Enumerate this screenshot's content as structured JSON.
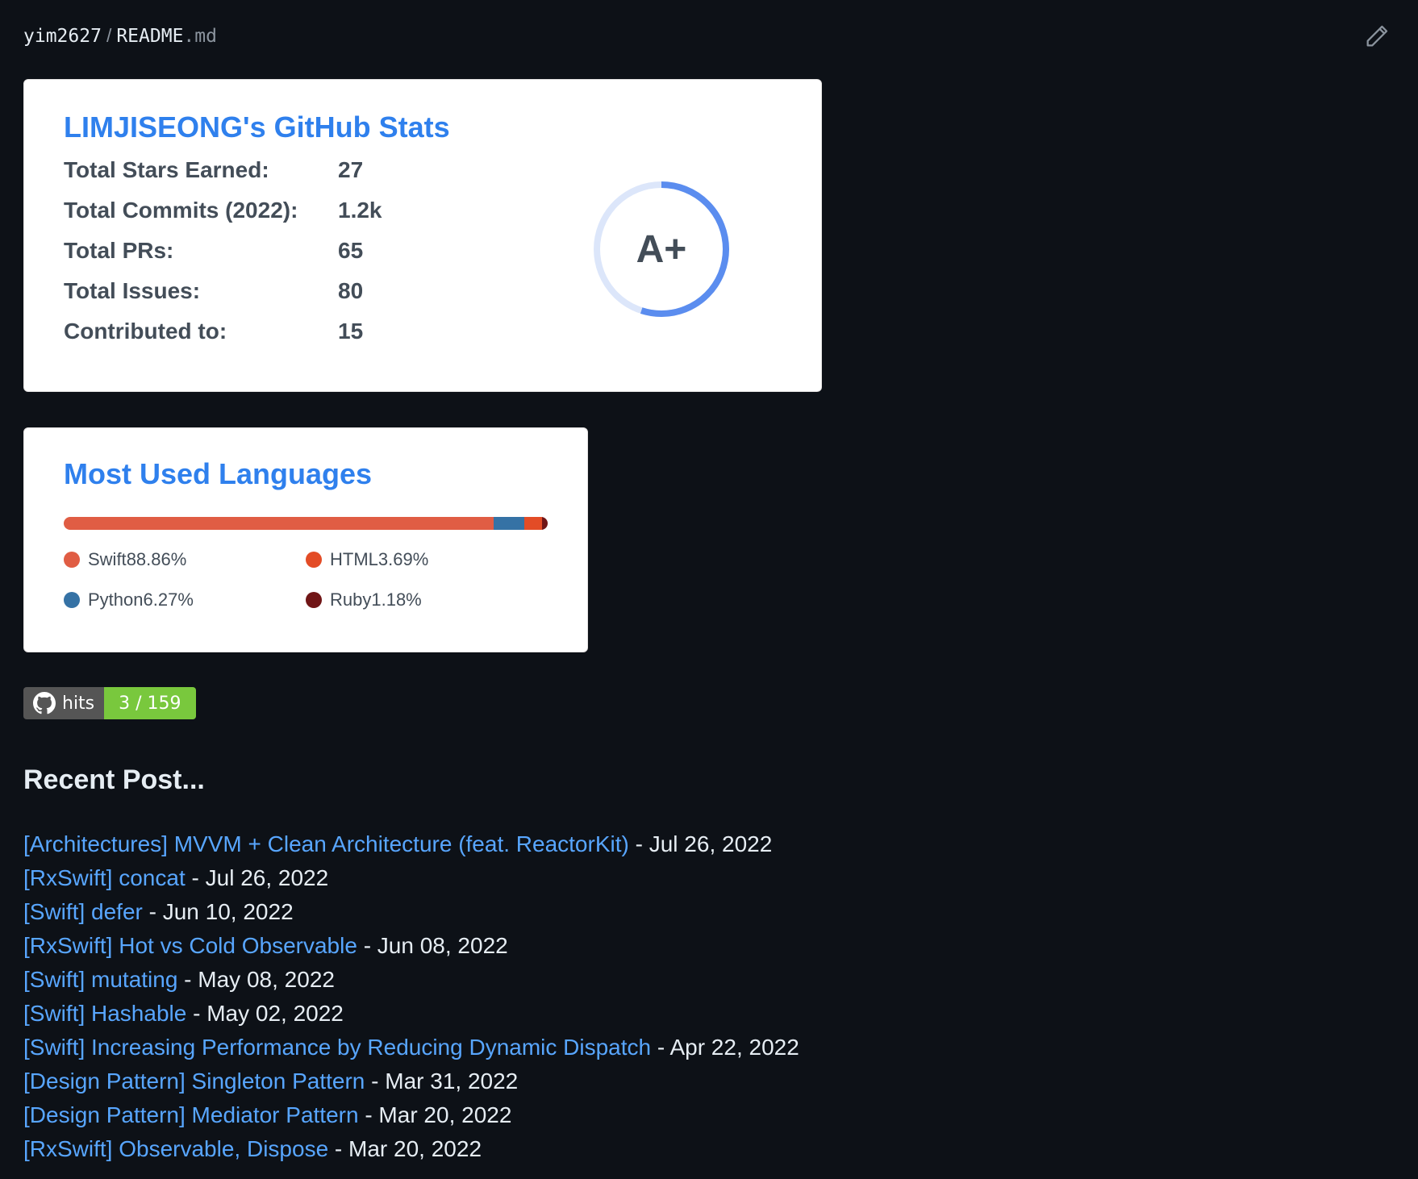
{
  "file_path": {
    "owner": "yim2627",
    "separator": "/",
    "filename": "README",
    "extension": ".md"
  },
  "stats_card": {
    "title": "LIMJISEONG's GitHub Stats",
    "rows": [
      {
        "label": "Total Stars Earned:",
        "value": "27"
      },
      {
        "label": "Total Commits (2022):",
        "value": "1.2k"
      },
      {
        "label": "Total PRs:",
        "value": "65"
      },
      {
        "label": "Total Issues:",
        "value": "80"
      },
      {
        "label": "Contributed to:",
        "value": "15"
      }
    ],
    "rank": "A+",
    "rank_progress": 0.55,
    "colors": {
      "title": "#2f80ed",
      "text": "#434d58",
      "ring": "#5b8def",
      "ring_track": "#dce6fa"
    }
  },
  "languages_card": {
    "title": "Most Used Languages",
    "languages": [
      {
        "name": "Swift",
        "percent": "88.86%",
        "value": 88.86,
        "color": "#e05d44"
      },
      {
        "name": "Python",
        "percent": "6.27%",
        "value": 6.27,
        "color": "#3572a5"
      },
      {
        "name": "HTML",
        "percent": "3.69%",
        "value": 3.69,
        "color": "#e34c26"
      },
      {
        "name": "Ruby",
        "percent": "1.18%",
        "value": 1.18,
        "color": "#701516"
      }
    ]
  },
  "hits_badge": {
    "label": "hits",
    "value": "3 / 159",
    "icon": "github-icon"
  },
  "recent_posts": {
    "heading": "Recent Post...",
    "items": [
      {
        "title": "[Architectures] MVVM + Clean Architecture (feat. ReactorKit)",
        "date": " - Jul 26, 2022"
      },
      {
        "title": "[RxSwift] concat",
        "date": " - Jul 26, 2022"
      },
      {
        "title": "[Swift] defer",
        "date": " - Jun 10, 2022"
      },
      {
        "title": "[RxSwift] Hot vs Cold Observable",
        "date": " - Jun 08, 2022"
      },
      {
        "title": "[Swift] mutating",
        "date": " - May 08, 2022"
      },
      {
        "title": "[Swift] Hashable",
        "date": " - May 02, 2022"
      },
      {
        "title": "[Swift] Increasing Performance by Reducing Dynamic Dispatch",
        "date": " - Apr 22, 2022"
      },
      {
        "title": "[Design Pattern] Singleton Pattern",
        "date": " - Mar 31, 2022"
      },
      {
        "title": "[Design Pattern] Mediator Pattern",
        "date": " - Mar 20, 2022"
      },
      {
        "title": "[RxSwift] Observable, Dispose",
        "date": " - Mar 20, 2022"
      }
    ]
  },
  "toolbar": {
    "edit_icon": "pencil-icon"
  }
}
